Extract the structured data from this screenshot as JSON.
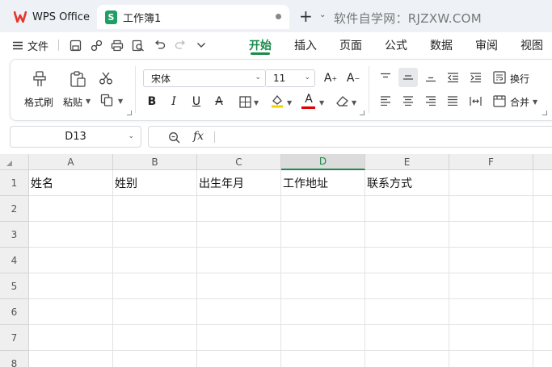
{
  "tabs": {
    "home_label": "WPS Office",
    "doc_label": "工作簿1",
    "doc_icon_letter": "S",
    "new_tab_symbol": "+",
    "watermark": "软件自学网：RJZXW.COM"
  },
  "menu": {
    "file_label": "文件",
    "tabs": [
      "开始",
      "插入",
      "页面",
      "公式",
      "数据",
      "审阅",
      "视图"
    ],
    "active_tab": "开始"
  },
  "ribbon": {
    "format_painter": "格式刷",
    "paste": "粘贴",
    "font_name": "宋体",
    "font_size": "11",
    "wrap_text": "换行",
    "merge": "合并",
    "bold": "B",
    "italic": "I",
    "underline": "U",
    "strike": "A",
    "font_color_letter": "A",
    "grow_font": "A",
    "shrink_font": "A"
  },
  "formula_bar": {
    "cell_ref": "D13",
    "fx": "fx",
    "content": ""
  },
  "grid": {
    "columns": [
      "A",
      "B",
      "C",
      "D",
      "E",
      "F"
    ],
    "selected_column": "D",
    "rows": [
      "1",
      "2",
      "3",
      "4",
      "5",
      "6",
      "7",
      "8"
    ],
    "header_row": [
      "姓名",
      "姓别",
      "出生年月",
      "工作地址",
      "联系方式",
      ""
    ]
  },
  "colors": {
    "accent_green": "#1b8a4a",
    "wps_red": "#e8342c",
    "sheet_icon_green": "#1f9f63",
    "font_color_red": "#e00000",
    "highlight_yellow": "#f5d100"
  }
}
